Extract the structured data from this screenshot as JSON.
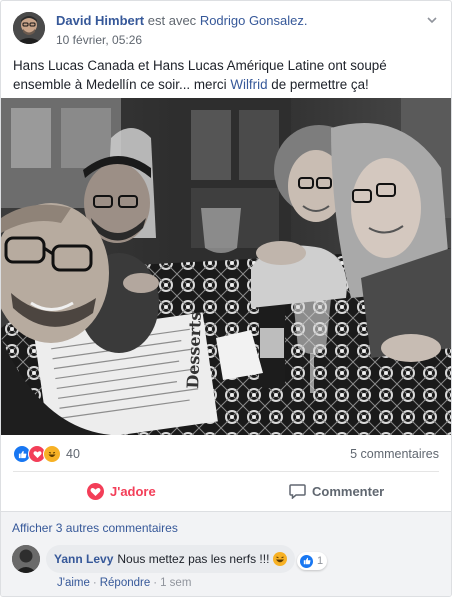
{
  "post": {
    "author": "David Himbert",
    "with_text": "est avec",
    "tagged": "Rodrigo Gonsalez.",
    "timestamp": "10 février, 05:26",
    "text_part1": "Hans Lucas Canada et Hans Lucas Amérique Latine ont soupé ensemble à Medellín ce soir... merci ",
    "text_mention": "Wilfrid",
    "text_part2": " de permettre ça!",
    "photo_menu_text": "Desserts"
  },
  "stats": {
    "reaction_icons": [
      "like-icon",
      "love-icon",
      "haha-icon"
    ],
    "reaction_count": "40",
    "comments_count": "5 commentaires"
  },
  "actions": {
    "love_label": "J'adore",
    "comment_label": "Commenter"
  },
  "comments": {
    "more_label": "Afficher 3 autres commentaires",
    "items": [
      {
        "author": "Yann Levy",
        "text": "Nous mettez pas les nerfs !!!",
        "reaction_count": "1",
        "like_label": "J'aime",
        "reply_label": "Répondre",
        "time": "1 sem"
      }
    ]
  },
  "colors": {
    "link": "#365899",
    "love": "#f33e58",
    "like": "#1877f2",
    "haha": "#f7b125",
    "muted": "#606770"
  }
}
